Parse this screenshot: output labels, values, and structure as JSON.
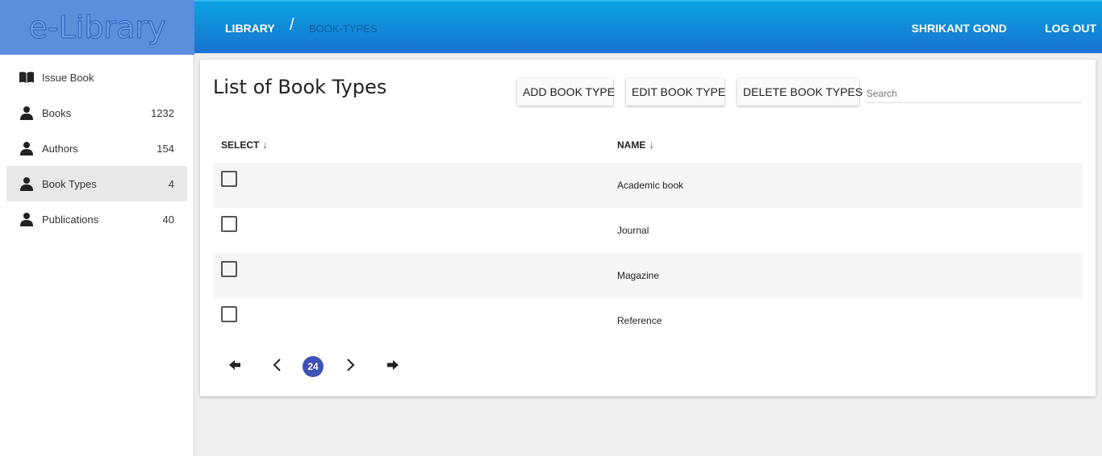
{
  "app": {
    "logo": "e-Library"
  },
  "header": {
    "breadcrumb_root": "LIBRARY",
    "breadcrumb_sep": "/",
    "breadcrumb_current": "BOOK-TYPES",
    "user_name": "SHRIKANT GOND",
    "logout_label": "LOG OUT"
  },
  "sidebar": {
    "items": [
      {
        "label": "Issue Book",
        "count": "",
        "icon": "book-open-icon",
        "active": false
      },
      {
        "label": "Books",
        "count": "1232",
        "icon": "person-icon",
        "active": false
      },
      {
        "label": "Authors",
        "count": "154",
        "icon": "person-icon",
        "active": false
      },
      {
        "label": "Book Types",
        "count": "4",
        "icon": "person-icon",
        "active": true
      },
      {
        "label": "Publications",
        "count": "40",
        "icon": "person-icon",
        "active": false
      }
    ]
  },
  "main": {
    "title": "List of Book Types",
    "add_label": "ADD BOOK TYPE",
    "edit_label": "EDIT BOOK TYPE",
    "delete_label": "DELETE BOOK TYPES",
    "search_placeholder": "Search",
    "columns": [
      "SELECT",
      "NAME"
    ],
    "sort_arrow": "↓",
    "rows": [
      {
        "name": "Academic book",
        "checked": false
      },
      {
        "name": "Journal",
        "checked": false
      },
      {
        "name": "Magazine",
        "checked": false
      },
      {
        "name": "Reference",
        "checked": false
      }
    ],
    "pagination": {
      "current_page": "24"
    }
  },
  "colors": {
    "header_top": "#0aa3e2",
    "header_bottom": "#1a72cf",
    "logo_bg": "#5b8edb",
    "page_badge": "#3f51b5"
  }
}
